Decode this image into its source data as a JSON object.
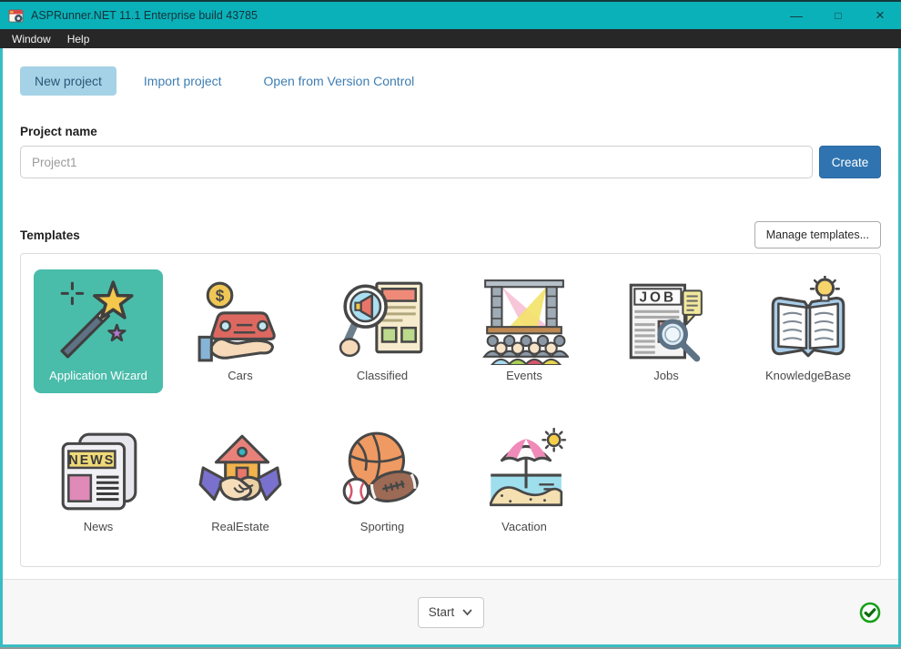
{
  "window": {
    "title": "ASPRunner.NET 11.1 Enterprise build 43785"
  },
  "titlebar_icons": {
    "minimize": "—",
    "maximize": "□",
    "close": "×"
  },
  "menubar": {
    "items": [
      "Window",
      "Help"
    ]
  },
  "tabs": {
    "items": [
      {
        "label": "New project",
        "selected": true
      },
      {
        "label": "Import project",
        "selected": false
      },
      {
        "label": "Open from Version Control",
        "selected": false
      }
    ]
  },
  "project": {
    "label": "Project name",
    "input_placeholder": "Project1",
    "create_button": "Create"
  },
  "templates": {
    "heading": "Templates",
    "manage_button": "Manage templates...",
    "tiles": [
      {
        "label": "Application Wizard",
        "icon": "magic-wand",
        "selected": true
      },
      {
        "label": "Cars",
        "icon": "car-in-hand",
        "selected": false
      },
      {
        "label": "Classified",
        "icon": "magnifier-megaphone",
        "selected": false
      },
      {
        "label": "Events",
        "icon": "stage-lights-crowd",
        "selected": false
      },
      {
        "label": "Jobs",
        "icon": "job-ads-magnifier",
        "selected": false
      },
      {
        "label": "KnowledgeBase",
        "icon": "book-lightbulb",
        "selected": false
      },
      {
        "label": "News",
        "icon": "newspaper",
        "selected": false
      },
      {
        "label": "RealEstate",
        "icon": "house-handshake",
        "selected": false
      },
      {
        "label": "Sporting",
        "icon": "sports-balls",
        "selected": false
      },
      {
        "label": "Vacation",
        "icon": "beach-umbrella-sun",
        "selected": false
      }
    ]
  },
  "icon_text": {
    "jobs_headline": "JOB",
    "news_headline": "NEWS",
    "coin_symbol": "$"
  },
  "footer": {
    "start_select": "Start"
  },
  "colors": {
    "titlebar": "#0bb1b9",
    "menubar": "#272727",
    "tab_selected_bg": "#a5d2e6",
    "accent_button": "#2f74b0",
    "selected_tile": "#49bcaa",
    "footer_bg": "#f7f7f7",
    "status_green": "#17a017"
  }
}
